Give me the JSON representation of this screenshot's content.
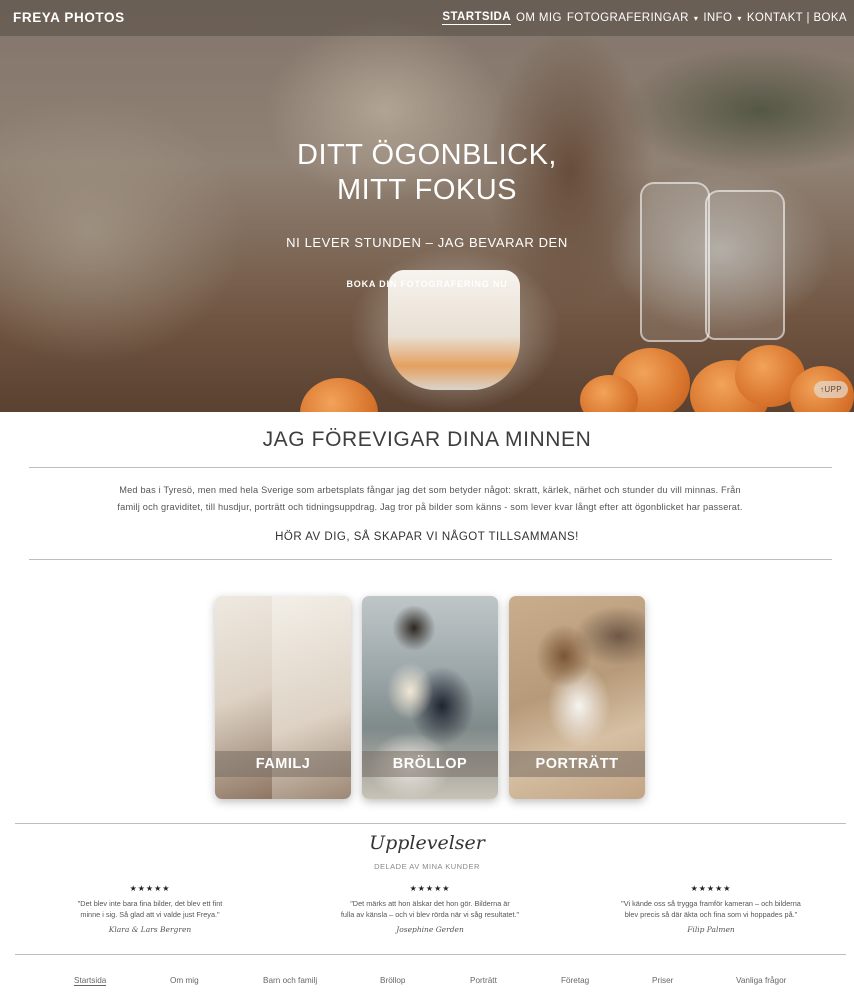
{
  "header": {
    "brand": "FREYA PHOTOS",
    "nav": [
      {
        "label": "STARTSIDA"
      },
      {
        "label": "OM MIG"
      },
      {
        "label": "FOTOGRAFERINGAR"
      },
      {
        "label": "INFO"
      },
      {
        "label": "KONTAKT | BOKA"
      }
    ],
    "caret": "▾"
  },
  "hero": {
    "title_line1": "DITT ÖGONBLICK,",
    "title_line2": "MITT FOKUS",
    "subtitle": "NI LEVER STUNDEN – JAG BEVARAR DEN",
    "cta": "BOKA DIN FOTOGRAFERING NU",
    "scroll_up": "↑UPP"
  },
  "intro": {
    "title": "JAG FÖREVIGAR DINA MINNEN",
    "text_line1": "Med bas i Tyresö, men med hela Sverige som arbetsplats fångar jag det som betyder något: skratt, kärlek, närhet och stunder du vill minnas. Från",
    "text_line2": "familj och graviditet, till husdjur, porträtt och tidningsuppdrag. Jag tror på bilder som känns - som lever kvar långt efter att ögonblicket har passerat.",
    "cta": "HÖR AV DIG, SÅ SKAPAR VI NÅGOT TILLSAMMANS!"
  },
  "categories": [
    {
      "label": "FAMILJ"
    },
    {
      "label": "BRÖLLOP"
    },
    {
      "label": "PORTRÄTT"
    }
  ],
  "reviews": {
    "title": "Upplevelser",
    "subtitle": "DELADE AV MINA KUNDER",
    "items": [
      {
        "stars": "★★★★★",
        "line1": "\"Det blev inte bara fina bilder, det blev ett fint",
        "line2": "minne i sig. Så glad att vi valde just Freya.\"",
        "author": "Klara & Lars Bergren"
      },
      {
        "stars": "★★★★★",
        "line1": "\"Det märks att hon älskar det hon gör. Bilderna är",
        "line2": "fulla av känsla – och vi blev rörda när vi såg resultatet.\"",
        "author": "Josephine Gerden"
      },
      {
        "stars": "★★★★★",
        "line1": "\"Vi kände oss så trygga framför kameran – och bilderna",
        "line2": "blev precis så där äkta och fina som vi hoppades på.\"",
        "author": "Filip Palmen"
      }
    ]
  },
  "footer": {
    "links": [
      "Startsida",
      "Om mig",
      "Barn och familj",
      "Bröllop",
      "Porträtt",
      "Företag",
      "Priser",
      "Vanliga frågor"
    ]
  }
}
